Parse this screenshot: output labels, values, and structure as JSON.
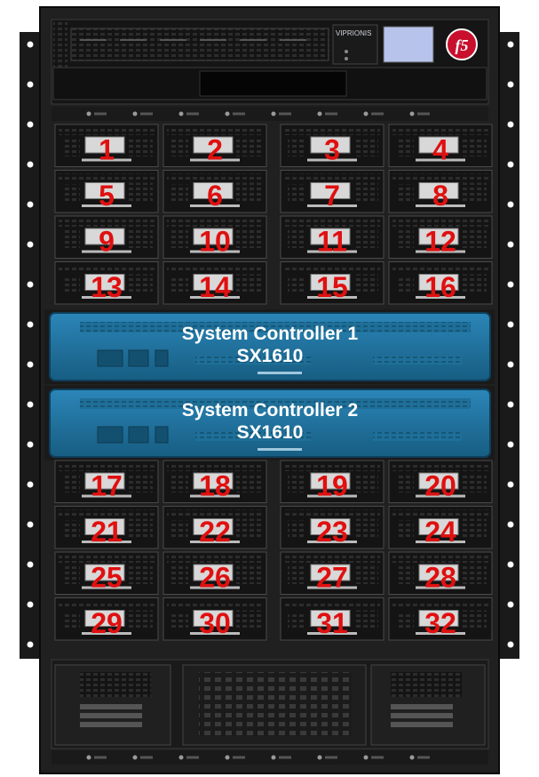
{
  "chassis": {
    "brand": "VIPRIONIS",
    "logo": "f5",
    "logo_color": "#c8102e",
    "frame_color": "#1c1c1c",
    "controller_color": "#1e6f99"
  },
  "blade_slots_top": [
    "1",
    "2",
    "3",
    "4",
    "5",
    "6",
    "7",
    "8",
    "9",
    "10",
    "11",
    "12",
    "13",
    "14",
    "15",
    "16"
  ],
  "blade_slots_bottom": [
    "17",
    "18",
    "19",
    "20",
    "21",
    "22",
    "23",
    "24",
    "25",
    "26",
    "27",
    "28",
    "29",
    "30",
    "31",
    "32"
  ],
  "controllers": [
    {
      "name": "System Controller 1",
      "model": "SX1610"
    },
    {
      "name": "System Controller 2",
      "model": "SX1610"
    }
  ],
  "number_color": "#e01010"
}
